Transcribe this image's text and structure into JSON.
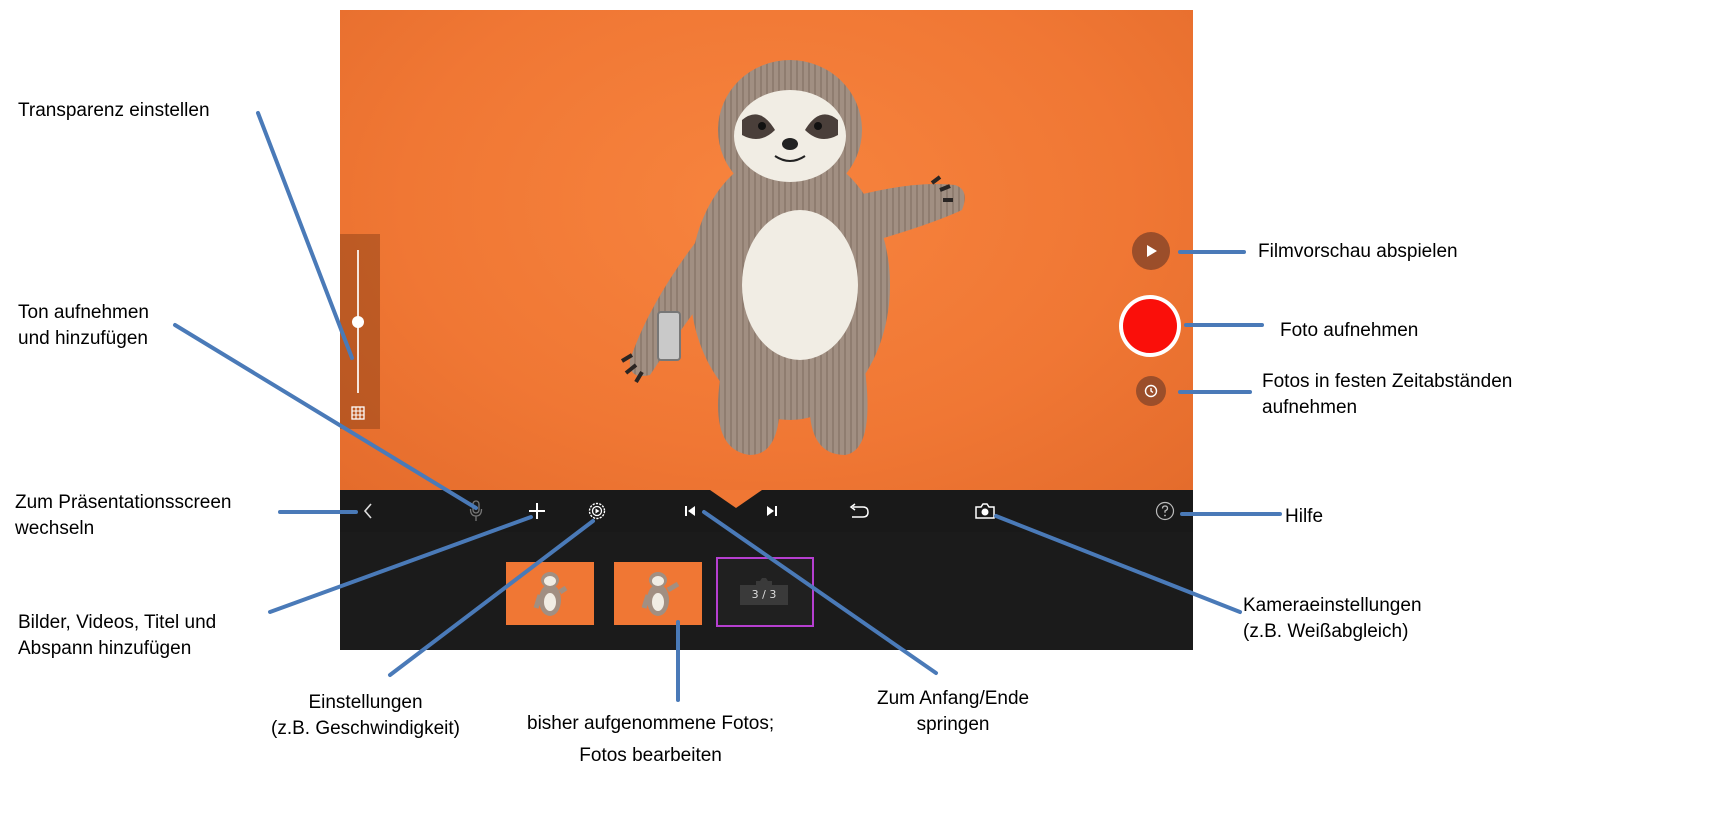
{
  "screen": {
    "frame_counter": "3 / 3",
    "colors": {
      "background_orange": "#f07734",
      "toolbar": "#191919",
      "record_red": "#fa0f0a",
      "side_button_brown": "#9b4e2a",
      "current_frame_border": "#b63fd0",
      "callout_line": "#4a7ab8"
    },
    "toolbar_icons": [
      "back-chevron-icon",
      "microphone-icon",
      "plus-icon",
      "settings-gear-icon",
      "skip-to-start-icon",
      "skip-to-end-icon",
      "undo-icon",
      "camera-icon",
      "help-icon"
    ],
    "side_icons": [
      "play-icon",
      "record-icon",
      "timer-icon"
    ],
    "opacity_slider_level": 0.5
  },
  "annotations": {
    "transparency": [
      "Transparenz einstellen"
    ],
    "record_sound": [
      "Ton aufnehmen",
      "und hinzufügen"
    ],
    "presentation_screen": [
      "Zum Präsentationsscreen",
      "wechseln"
    ],
    "add_media": [
      "Bilder, Videos, Titel und",
      "Abspann hinzufügen"
    ],
    "settings": [
      "Einstellungen",
      "(z.B. Geschwindigkeit)"
    ],
    "photos": [
      "bisher aufgenommene Fotos;",
      "Fotos bearbeiten"
    ],
    "jump": [
      "Zum Anfang/Ende",
      "springen"
    ],
    "play_preview": [
      "Filmvorschau abspielen"
    ],
    "take_photo": [
      "Foto aufnehmen"
    ],
    "timelapse": [
      "Fotos in festen Zeitabständen",
      "aufnehmen"
    ],
    "help": [
      "Hilfe"
    ],
    "camera_settings": [
      "Kameraeinstellungen",
      "(z.B. Weißabgleich)"
    ]
  }
}
